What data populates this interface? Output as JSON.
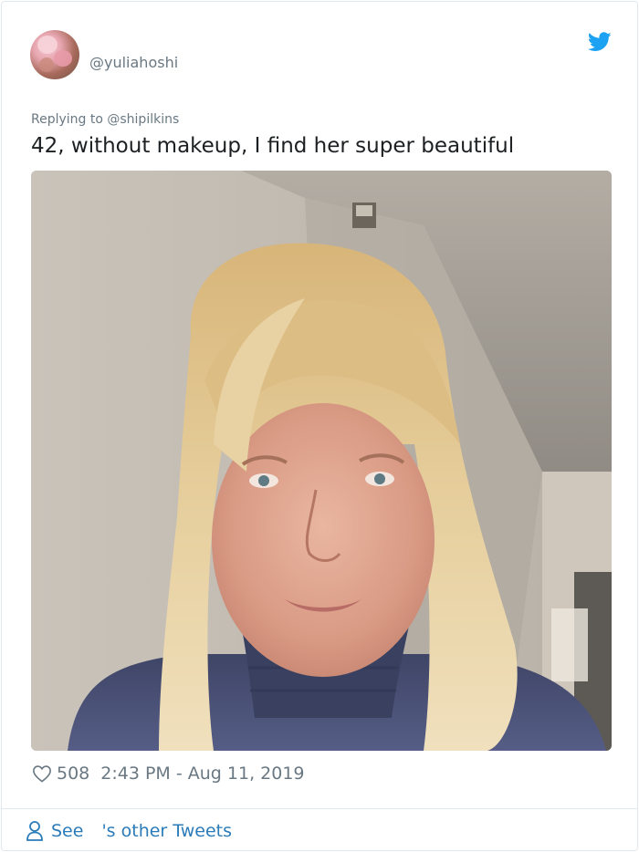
{
  "tweet": {
    "handle": "@yuliahoshi",
    "replying_to": "Replying to @shipilkins",
    "text": "42, without makeup, I find her super beautiful",
    "likes": "508",
    "timestamp": "2:43 PM - Aug 11, 2019"
  },
  "footer": {
    "see_label": "See",
    "other_tweets_label": "'s other Tweets"
  },
  "icons": {
    "brand": "twitter-bird-icon",
    "like": "heart-icon",
    "profile": "person-icon"
  },
  "colors": {
    "twitter_blue": "#1da1f2",
    "link_blue": "#2b7bb9",
    "muted_text": "#697882",
    "body_text": "#1c2022"
  }
}
